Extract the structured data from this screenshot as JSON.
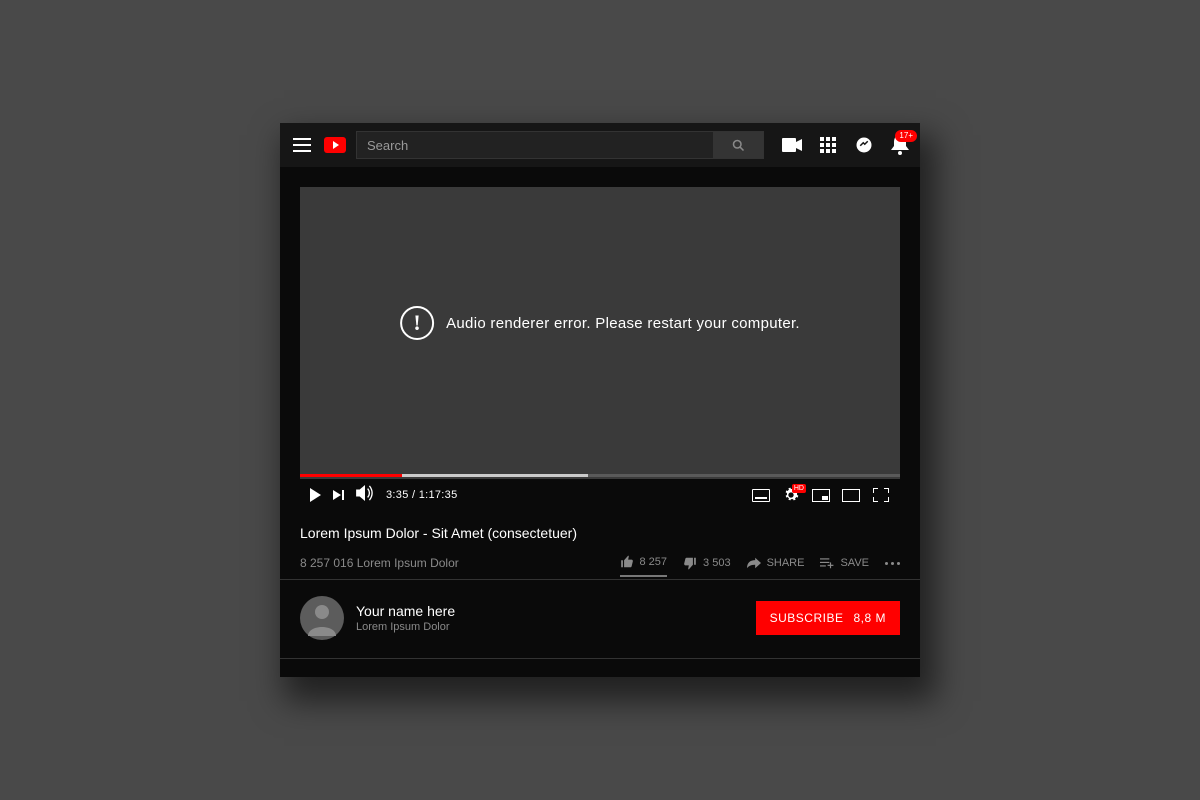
{
  "header": {
    "search_placeholder": "Search",
    "notification_badge": "17+"
  },
  "player": {
    "error_message": "Audio renderer error. Please restart your computer.",
    "time_current": "3:35",
    "time_separator": " / ",
    "time_total": "1:17:35",
    "buffer_pct": "48%",
    "play_pct": "17%",
    "hd_label": "HD"
  },
  "meta": {
    "title": "Lorem Ipsum Dolor - Sit Amet (consectetuer)",
    "views_text": "8 257 016 Lorem Ipsum Dolor",
    "likes": "8 257",
    "dislikes": "3 503",
    "share_label": "SHARE",
    "save_label": "SAVE"
  },
  "channel": {
    "name": "Your name here",
    "subtitle": "Lorem Ipsum Dolor",
    "subscribe_label": "SUBSCRIBE",
    "subscribe_count": "8,8 M"
  }
}
